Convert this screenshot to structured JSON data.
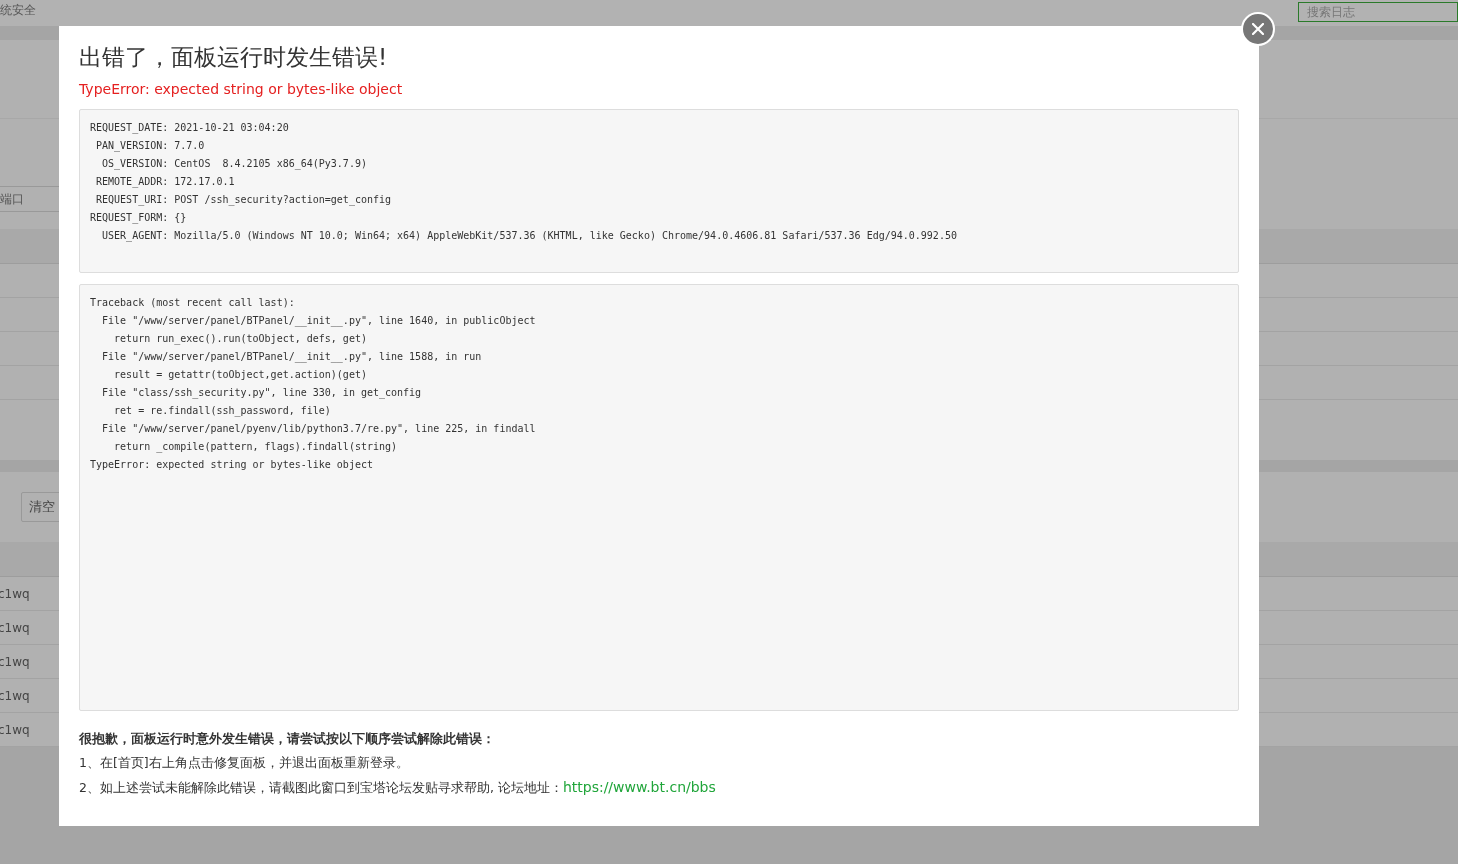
{
  "background": {
    "page_title": "统安全",
    "search": {
      "placeholder": "搜索日志"
    },
    "port_field": {
      "placeholder": "端口"
    },
    "clear_button": "清空",
    "log_rows": [
      "c1wq",
      "c1wq",
      "c1wq",
      "c1wq",
      "c1wq"
    ]
  },
  "modal": {
    "title": "出错了，面板运行时发生错误!",
    "error": "TypeError: expected string or bytes-like object",
    "request_info": [
      "REQUEST_DATE: 2021-10-21 03:04:20",
      " PAN_VERSION: 7.7.0",
      "  OS_VERSION: CentOS  8.4.2105 x86_64(Py3.7.9)",
      " REMOTE_ADDR: 172.17.0.1",
      " REQUEST_URI: POST /ssh_security?action=get_config",
      "REQUEST_FORM: {}",
      "  USER_AGENT: Mozilla/5.0 (Windows NT 10.0; Win64; x64) AppleWebKit/537.36 (KHTML, like Gecko) Chrome/94.0.4606.81 Safari/537.36 Edg/94.0.992.50"
    ],
    "traceback": [
      "Traceback (most recent call last):",
      "  File \"/www/server/panel/BTPanel/__init__.py\", line 1640, in publicObject",
      "    return run_exec().run(toObject, defs, get)",
      "  File \"/www/server/panel/BTPanel/__init__.py\", line 1588, in run",
      "    result = getattr(toObject,get.action)(get)",
      "  File \"class/ssh_security.py\", line 330, in get_config",
      "    ret = re.findall(ssh_password, file)",
      "  File \"/www/server/panel/pyenv/lib/python3.7/re.py\", line 225, in findall",
      "    return _compile(pattern, flags).findall(string)",
      "TypeError: expected string or bytes-like object"
    ],
    "help_heading": "很抱歉，面板运行时意外发生错误，请尝试按以下顺序尝试解除此错误：",
    "steps": [
      {
        "text": "1、在[首页]右上角点击修复面板，并退出面板重新登录。"
      },
      {
        "text": "2、如上述尝试未能解除此错误，请截图此窗口到宝塔论坛发贴寻求帮助, 论坛地址：",
        "link": "https://www.bt.cn/bbs"
      }
    ]
  }
}
